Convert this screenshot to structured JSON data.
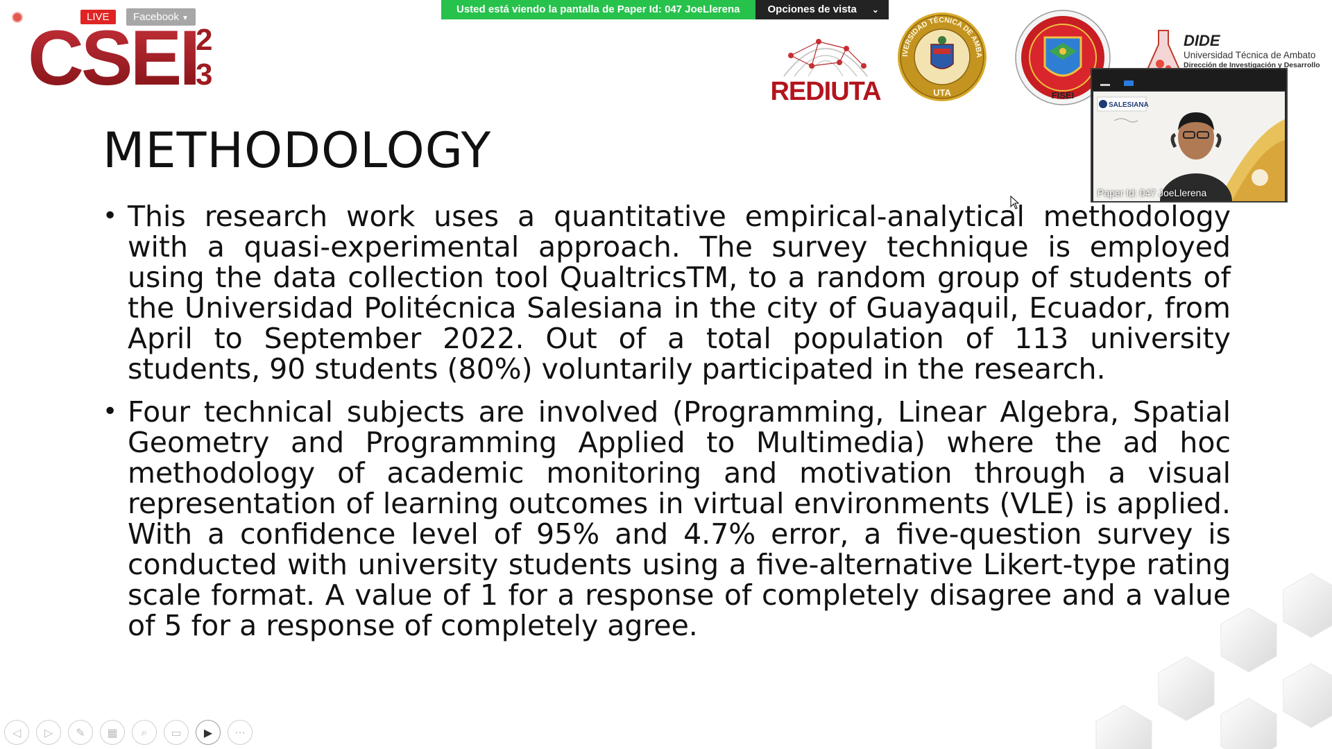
{
  "share_banner": {
    "viewing_text": "Usted está viendo la pantalla de Paper Id: 047 JoeLlerena",
    "options_label": "Opciones de vista"
  },
  "stream": {
    "live_label": "LIVE",
    "platform_label": "Facebook"
  },
  "logos": {
    "csei": "CSEI",
    "csei_sup": "2",
    "csei_sub": "3",
    "rediuta": "REDIUTA",
    "uta": "UNIVERSIDAD TÉCNICA DE AMBATO",
    "uta_short": "UTA",
    "fisei": "FISEI",
    "dide_title": "DIDE",
    "dide_sub": "Universidad Técnica de Ambato",
    "dide_sub2": "Dirección de Investigación y Desarrollo"
  },
  "video": {
    "participant_name": "Paper Id: 047 JoeLlerena",
    "slide_logo_text": "SALESIANA"
  },
  "slide": {
    "title": "METHODOLOGY",
    "bullets": [
      "This research work uses a quantitative empirical-analytical methodology with a quasi-experimental approach. The survey technique is employed using the data collection tool QualtricsTM, to a random group of students of the Universidad Politécnica Salesiana in the city of Guayaquil, Ecuador, from April to September 2022. Out of a total population of 113 university students, 90 students (80%) voluntarily participated in the research.",
      "Four technical subjects are involved (Programming, Linear Algebra, Spatial Geometry and Programming Applied to Multimedia) where the ad hoc methodology of academic monitoring and motivation through a visual representation of learning outcomes in virtual environments (VLE) is applied. With a confidence level of 95% and 4.7% error, a five-question survey is conducted with university students using a five-alternative Likert-type rating scale format. A value of 1 for a response of completely disagree and a value of 5 for a response of completely agree."
    ]
  },
  "controls": [
    {
      "name": "previous-slide-button",
      "icon": "arrow-left-icon",
      "glyph": "◁"
    },
    {
      "name": "next-slide-button",
      "icon": "arrow-right-icon",
      "glyph": "▷"
    },
    {
      "name": "pen-button",
      "icon": "pen-icon",
      "glyph": "✎"
    },
    {
      "name": "slides-overview-button",
      "icon": "grid-icon",
      "glyph": "▦"
    },
    {
      "name": "zoom-button",
      "icon": "zoom-icon",
      "glyph": "⌕"
    },
    {
      "name": "subtitles-button",
      "icon": "subtitles-icon",
      "glyph": "▭"
    },
    {
      "name": "camera-button",
      "icon": "camera-icon",
      "glyph": "▶"
    },
    {
      "name": "more-options-button",
      "icon": "more-icon",
      "glyph": "···"
    }
  ],
  "colors": {
    "banner_green": "#27c24c",
    "banner_dark": "#232323",
    "live_red": "#e02424",
    "csei_red": "#9e1b1f"
  }
}
